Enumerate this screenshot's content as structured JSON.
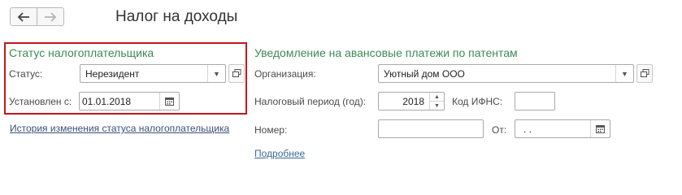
{
  "header": {
    "title": "Налог на доходы",
    "back_icon": "arrow-left-icon",
    "forward_icon": "arrow-right-icon"
  },
  "taxpayer_status": {
    "section_title": "Статус налогоплательщика",
    "status_label": "Статус:",
    "status_value": "Нерезидент",
    "established_label": "Установлен с:",
    "established_value": "01.01.2018",
    "history_link": "История изменения статуса налогоплательщика",
    "highlight_color": "#c4161c"
  },
  "patent_notice": {
    "section_title": "Уведомление на авансовые платежи по патентам",
    "organization_label": "Организация:",
    "organization_value": "Уютный дом ООО",
    "tax_period_label": "Налоговый период (год):",
    "tax_period_value": "2018",
    "ifns_label": "Код ИФНС:",
    "ifns_value": "",
    "number_label": "Номер:",
    "number_value": "",
    "from_label": "От:",
    "from_value": ". .",
    "details_link": "Подробнее"
  },
  "colors": {
    "section_title": "#3c8a57",
    "link": "#3a4f7a"
  }
}
